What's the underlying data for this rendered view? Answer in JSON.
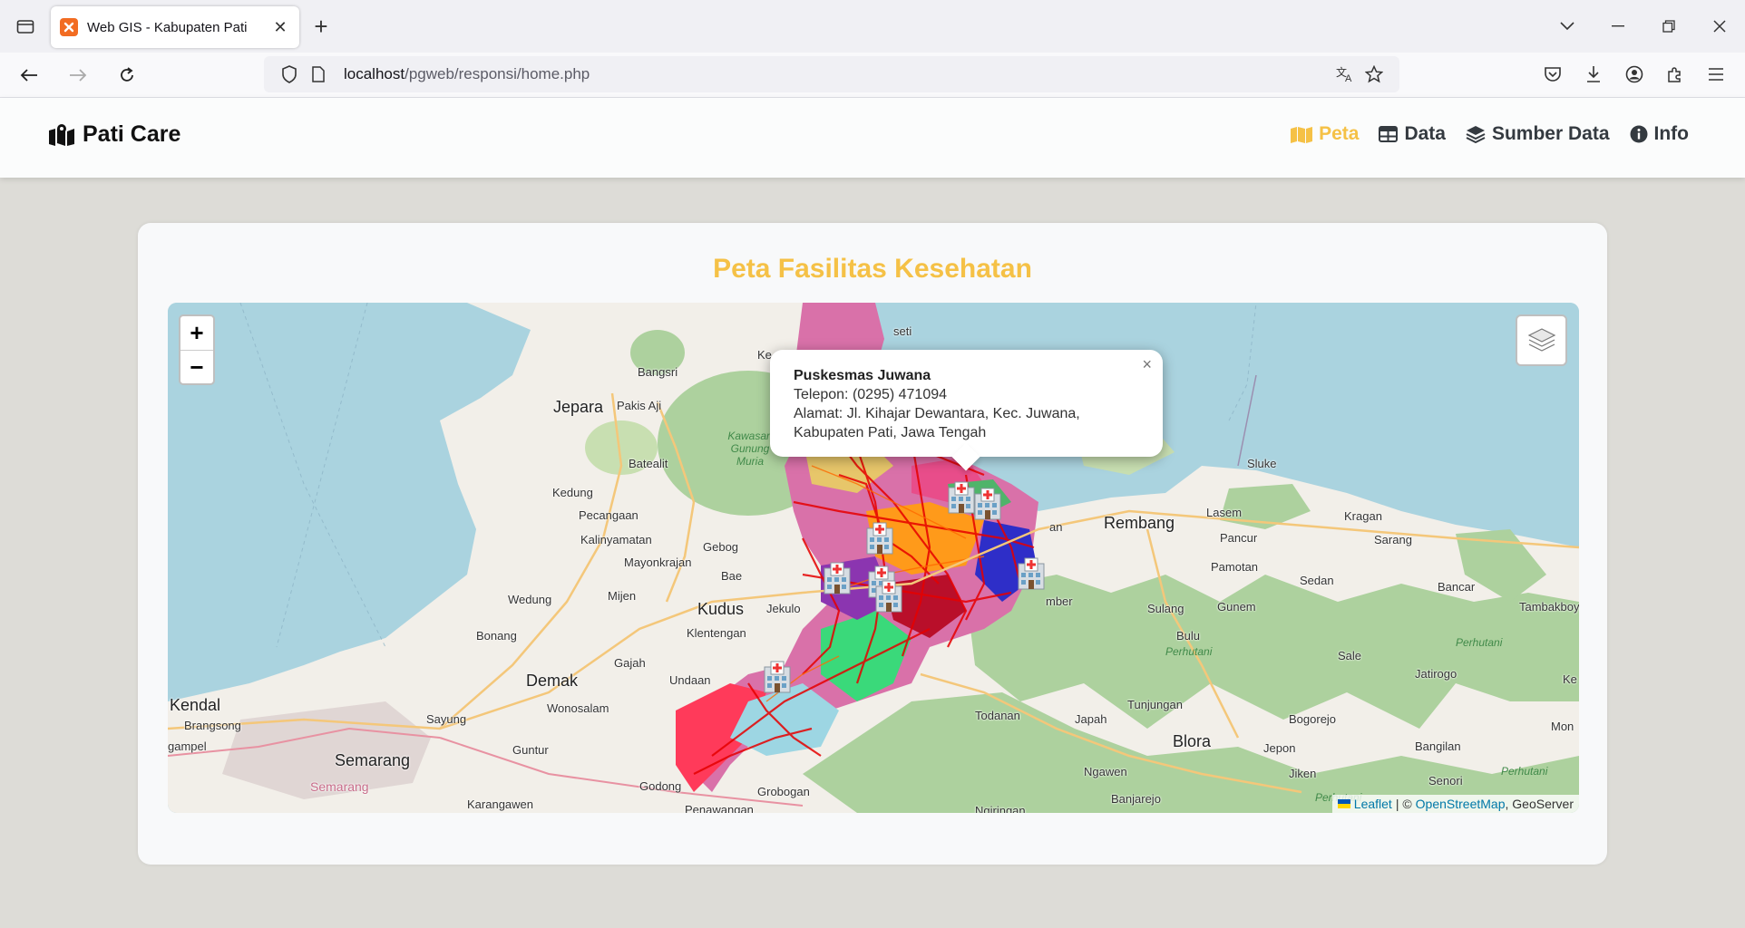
{
  "browser": {
    "tab_title": "Web GIS - Kabupaten Pati",
    "url_host": "localhost",
    "url_path": "/pgweb/responsi/home.php"
  },
  "site": {
    "brand": "Pati Care",
    "menu": [
      {
        "label": "Peta",
        "icon": "map-icon",
        "active": true
      },
      {
        "label": "Data",
        "icon": "table-icon",
        "active": false
      },
      {
        "label": "Sumber Data",
        "icon": "layers-icon",
        "active": false
      },
      {
        "label": "Info",
        "icon": "info-circle-icon",
        "active": false
      }
    ],
    "accent_color": "#f5c146"
  },
  "card": {
    "title": "Peta Fasilitas Kesehatan"
  },
  "map": {
    "zoom_in": "+",
    "zoom_out": "−",
    "popup": {
      "title": "Puskesmas Juwana",
      "phone": "Telepon: (0295) 471094",
      "address_line1": "Alamat: Jl. Kihajar Dewantara, Kec. Juwana,",
      "address_line2": "Kabupaten Pati, Jawa Tengah",
      "close": "×"
    },
    "attribution": {
      "leaflet": "Leaflet",
      "sep": "| ©",
      "osm": "OpenStreetMap",
      "geoserver": ", GeoServer"
    },
    "place_labels": {
      "jepara": "Jepara",
      "pakis_aji": "Pakis Aji",
      "bangsri": "Bangsri",
      "batealit": "Batealit",
      "kedung": "Kedung",
      "pecangaan": "Pecangaan",
      "kalinyamatan": "Kalinyamatan",
      "mayong": "Mayonkrajan",
      "gebog": "Gebog",
      "bae": "Bae",
      "wedung": "Wedung",
      "mijen": "Mijen",
      "kudus": "Kudus",
      "jekulo": "Jekulo",
      "bonang": "Bonang",
      "klentengan": "Klentengan",
      "gajah": "Gajah",
      "demak": "Demak",
      "undaan": "Undaan",
      "wonosalam": "Wonosalam",
      "kendal": "Kendal",
      "brangsong": "Brangsong",
      "sayung": "Sayung",
      "gampel": "gampel",
      "semarang": "Semarang",
      "semarang2": "Semarang",
      "guntur": "Guntur",
      "godong": "Godong",
      "grobogan": "Grobogan",
      "karangawen": "Karangawen",
      "penawangan": "Penawangan",
      "kawasan": "Kawasan Gunung Muria",
      "rembang": "Rembang",
      "lasem": "Lasem",
      "pancur": "Pancur",
      "sluke": "Sluke",
      "kragan": "Kragan",
      "sarang": "Sarang",
      "pamotan": "Pamotan",
      "sedan": "Sedan",
      "bancar": "Bancar",
      "tambakboyo": "Tambakboyo",
      "sulang": "Sulang",
      "gunem": "Gunem",
      "bulu": "Bulu",
      "perhutani1": "Perhutani",
      "perhutani2": "Perhutani",
      "perhutani3": "Perhutani",
      "perhutani4": "Perhutani",
      "sale": "Sale",
      "jatirogo": "Jatirogo",
      "todanan": "Todanan",
      "japah": "Japah",
      "tunjungan": "Tunjungan",
      "blora": "Blora",
      "bogorejo": "Bogorejo",
      "jepon": "Jepon",
      "bangilan": "Bangilan",
      "senori": "Senori",
      "jiken": "Jiken",
      "ngawen": "Ngawen",
      "banjarejo": "Banjarejo",
      "ngiringan": "Ngiringan",
      "mon": "Mon",
      "ke": "Ke",
      "an": "an",
      "mber": "mber",
      "seti": "seti",
      "kel": "Ke"
    }
  }
}
